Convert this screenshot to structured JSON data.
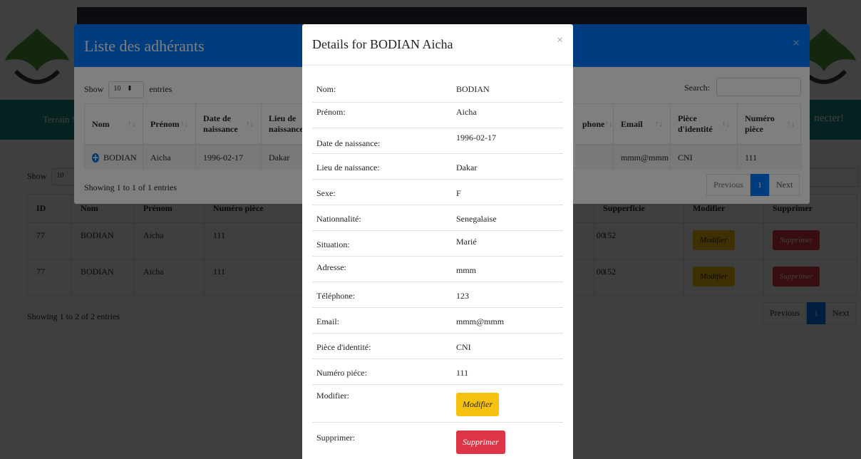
{
  "background": {
    "nav_terrain": "Terrain !",
    "nav_connect": "necter!",
    "show_label": "Show",
    "show_value": "10",
    "table": {
      "headers": [
        "ID",
        "Nom",
        "Prénom",
        "Numéro pièce",
        "",
        "Supperficie",
        "Modifier",
        "Supprimer"
      ],
      "rows": [
        [
          "77",
          "BODIAN",
          "Aicha",
          "111",
          "00",
          "152",
          "Modifier",
          "Supprimer"
        ],
        [
          "77",
          "BODIAN",
          "Aicha",
          "111",
          "00",
          "152",
          "Modifier",
          "Supprimer"
        ]
      ]
    },
    "info": "Showing 1 to 2 of 2 entries",
    "pager": {
      "previous": "Previous",
      "current": "1",
      "next": "Next"
    }
  },
  "list_modal": {
    "title": "Liste des adhérants",
    "close": "×",
    "show_label": "Show",
    "show_value": "10",
    "entries_label": "entries",
    "search_label": "Search:",
    "headers": {
      "nom": "Nom",
      "prenom": "Prénom",
      "date_naissance": "Date de naissance",
      "lieu_naissance": "Lieu de naissance",
      "telephone": "phone",
      "email": "Email",
      "piece": "Pièce d'identité",
      "numero_piece": "Numéro pièce"
    },
    "row": {
      "nom": "BODIAN",
      "prenom": "Aicha",
      "date_naissance": "1996-02-17",
      "lieu_naissance": "Dakar",
      "email": "mmm@mmm",
      "piece": "CNI",
      "numero_piece": "111"
    },
    "info": "Showing 1 to 1 of 1 entries",
    "pager": {
      "previous": "Previous",
      "current": "1",
      "next": "Next"
    }
  },
  "details_modal": {
    "title": "Details for BODIAN Aicha",
    "close": "×",
    "rows": [
      {
        "label": "Nom:",
        "value": "BODIAN"
      },
      {
        "label": "Prénom:",
        "value": "Aicha"
      },
      {
        "label": "Date de naissance:",
        "value": "1996-02-17"
      },
      {
        "label": "Lieu de naissance:",
        "value": "Dakar"
      },
      {
        "label": "Sexe:",
        "value": "F"
      },
      {
        "label": "Nationnalité:",
        "value": "Senegalaise"
      },
      {
        "label": "Situation:",
        "value": "Marié"
      },
      {
        "label": "Adresse:",
        "value": "mmm"
      },
      {
        "label": "Téléphone:",
        "value": "123"
      },
      {
        "label": "Email:",
        "value": "mmm@mmm"
      },
      {
        "label": "Pièce d'identité:",
        "value": "CNI"
      },
      {
        "label": "Numéro piéce:",
        "value": "111"
      }
    ],
    "modifier_label": "Modifier:",
    "modifier_button": "Modifier",
    "supprimer_label": "Supprimer:",
    "supprimer_button": "Supprimer"
  },
  "colors": {
    "primary": "#007bff",
    "teal_nav": "#1b8a80",
    "warning": "#f6c10f",
    "danger": "#dc3545"
  }
}
